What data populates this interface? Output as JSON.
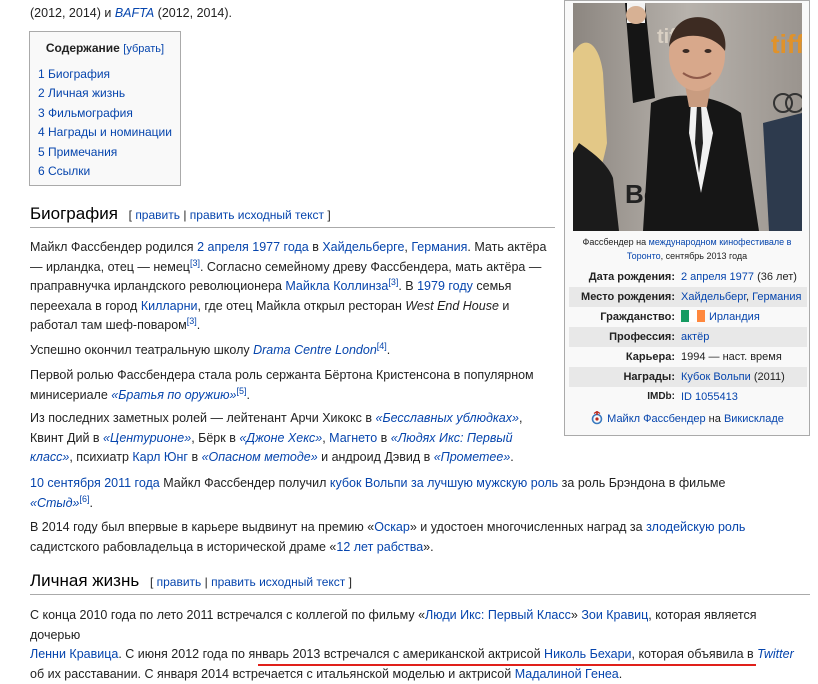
{
  "top_line": {
    "pre": "(2012, 2014) и ",
    "bafta": "BAFTA",
    "post": " (2012, 2014)."
  },
  "toc": {
    "title": "Содержание",
    "toggle": "[убрать]",
    "items": [
      "1 Биография",
      "2 Личная жизнь",
      "3 Фильмография",
      "4 Награды и номинации",
      "5 Примечания",
      "6 Ссылки"
    ]
  },
  "edit_links": {
    "open": "[ ",
    "edit": "править",
    "sep": " | ",
    "edit_source": "править исходный текст",
    "close": " ]"
  },
  "biography": {
    "heading": "Биография",
    "p1": {
      "t1": "Майкл Фассбендер родился ",
      "l1": "2 апреля",
      "t2": " ",
      "l2": "1977 года",
      "t3": " в ",
      "l3": "Хайдельберге",
      "t4": ", ",
      "l4": "Германия",
      "t5": ". Мать актёра — ирландка, отец — немец",
      "r1": "[3]",
      "t6": ". Согласно семейному древу Фассбендера, мать актёра — праправнучка ирландского революционера ",
      "l5": "Майкла Коллинза",
      "r2": "[3]",
      "t7": ". В ",
      "l6": "1979 году",
      "t8": " семья переехала в город ",
      "l7": "Килларни",
      "t9": ", где отец Майкла открыл ресторан ",
      "i1": "West End House",
      "t10": " и работал там шеф-поваром",
      "r3": "[3]",
      "t11": "."
    },
    "p2": {
      "t1": "Успешно окончил театральную школу ",
      "l1": "Drama Centre London",
      "r1": "[4]",
      "t2": "."
    },
    "p3": {
      "t1": "Первой ролью Фассбендера стала роль сержанта Бёртона Кристенсона в популярном минисериале ",
      "l1": "«Братья по оружию»",
      "r1": "[5]",
      "t2": "."
    },
    "p4": {
      "t1": "Из последних заметных ролей — лейтенант Арчи Хикокс в ",
      "l1": "«Бесславных ублюдках»",
      "t2": ", Квинт Дий в ",
      "l2": "«Центурионе»",
      "t3": ", Бёрк в ",
      "l3": "«Джоне Хекс»",
      "t4": ", ",
      "l4": "Магнето",
      "t5": " в ",
      "l5": "«Людях Икс: Первый класс»",
      "t6": ", психиатр ",
      "l6": "Карл Юнг",
      "t7": " в ",
      "l7": "«Опасном методе»",
      "t8": " и андроид Дэвид в ",
      "l8": "«Прометее»",
      "t9": "."
    },
    "p5": {
      "l1": "10 сентября",
      "t1": " ",
      "l2": "2011 года",
      "t2": " Майкл Фассбендер получил ",
      "l3": "кубок Вольпи за лучшую мужскую роль",
      "t3": " за роль Брэндона в фильме ",
      "l4": "«Стыд»",
      "r1": "[6]",
      "t4": "."
    },
    "p6": {
      "t1": "В 2014 году был впервые в карьере выдвинут на премию «",
      "l1": "Оскар",
      "t2": "» и удостоен многочисленных наград за ",
      "l2": "злодейскую роль",
      "t3": " садистского рабовладельца в исторической драме «",
      "l3": "12 лет рабства",
      "t4": "»."
    }
  },
  "personal": {
    "heading": "Личная жизнь",
    "p1": {
      "t1": "С конца 2010 года по лето 2011 встречался с коллегой по фильму «",
      "l1": "Люди Икс: Первый Класс",
      "t2": "» ",
      "l2": "Зои Кравиц",
      "t3": ", которая является дочерью ",
      "l3": "Ленни Кравица",
      "t4": ". С июня 2012 года по январь 2013 встречался с американской актрисой ",
      "l4": "Николь Бехари",
      "t5": ", которая объявила в ",
      "l5": "Twitter",
      "t6": " об их расставании. ",
      "hl": "С января 2014 встречается с итальянской моделью и актрисой ",
      "l6": "Мадалиной Генеа",
      "t7": "."
    }
  },
  "infobox": {
    "photo_sign": "tiff.",
    "photo_sign2": "Be",
    "caption": {
      "t1": "Фассбендер на ",
      "l1": "международном кинофестивале в Торонто",
      "t2": ", сентябрь 2013 года"
    },
    "rows": [
      {
        "label": "Дата рождения:",
        "v1": "2 апреля 1977",
        "v2": " (36 лет)"
      },
      {
        "label": "Место рождения:",
        "v1": "Хайдельберг",
        "v2": ", ",
        "v3": "Германия"
      },
      {
        "label": "Гражданство:",
        "v1": "Ирландия"
      },
      {
        "label": "Профессия:",
        "v1": "актёр"
      },
      {
        "label": "Карьера:",
        "v1": "1994 — наст. время"
      },
      {
        "label": "Награды:",
        "v1": "Кубок Вольпи",
        "v2": " (2011)"
      },
      {
        "label": "IMDb:",
        "v1": "ID 1055413"
      }
    ],
    "wikisklad": {
      "l1": "Майкл Фассбендер",
      "t1": " на ",
      "l2": "Викискладе"
    },
    "colors": {
      "flag_green": "#169b62",
      "flag_white": "#ffffff",
      "flag_orange": "#ff883e"
    }
  },
  "highlight_color": "#e0201a"
}
